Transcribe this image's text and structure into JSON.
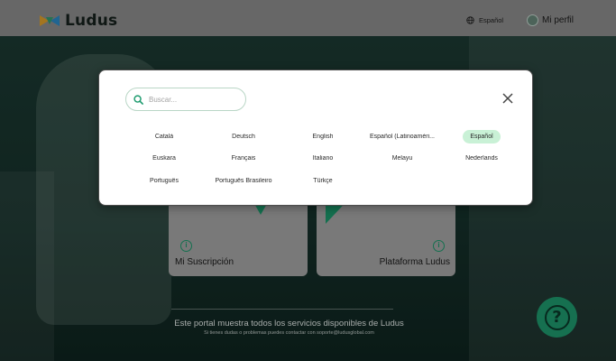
{
  "header": {
    "logo_text": "Ludus",
    "language_label": "Español",
    "profile_label": "Mi perfil"
  },
  "cards": [
    {
      "title": "Mi Suscripción",
      "info_icon": "info-icon"
    },
    {
      "title": "Plataforma Ludus",
      "info_icon": "info-icon"
    }
  ],
  "footer": {
    "main": "Este portal muestra todos los servicios disponibles de Ludus",
    "sub": "Si tienes dudas o problemas puedes contactar con soporte@ludusglobal.com"
  },
  "help_button": {
    "icon": "question-icon",
    "glyph": "?"
  },
  "language_modal": {
    "search_placeholder": "Buscar...",
    "selected": "Español",
    "rows": [
      [
        "Català",
        "Deutsch",
        "English",
        "Español (Latinoaméri...",
        "Español"
      ],
      [
        "Euskara",
        "Français",
        "Italiano",
        "Melayu",
        "Nederlands"
      ],
      [
        "Português",
        "Português Brasileiro",
        "Türkçe"
      ]
    ]
  },
  "colors": {
    "accent": "#1d9b6e",
    "selected_bg": "#c9f1d6",
    "header_bg": "#8f8f8f"
  }
}
